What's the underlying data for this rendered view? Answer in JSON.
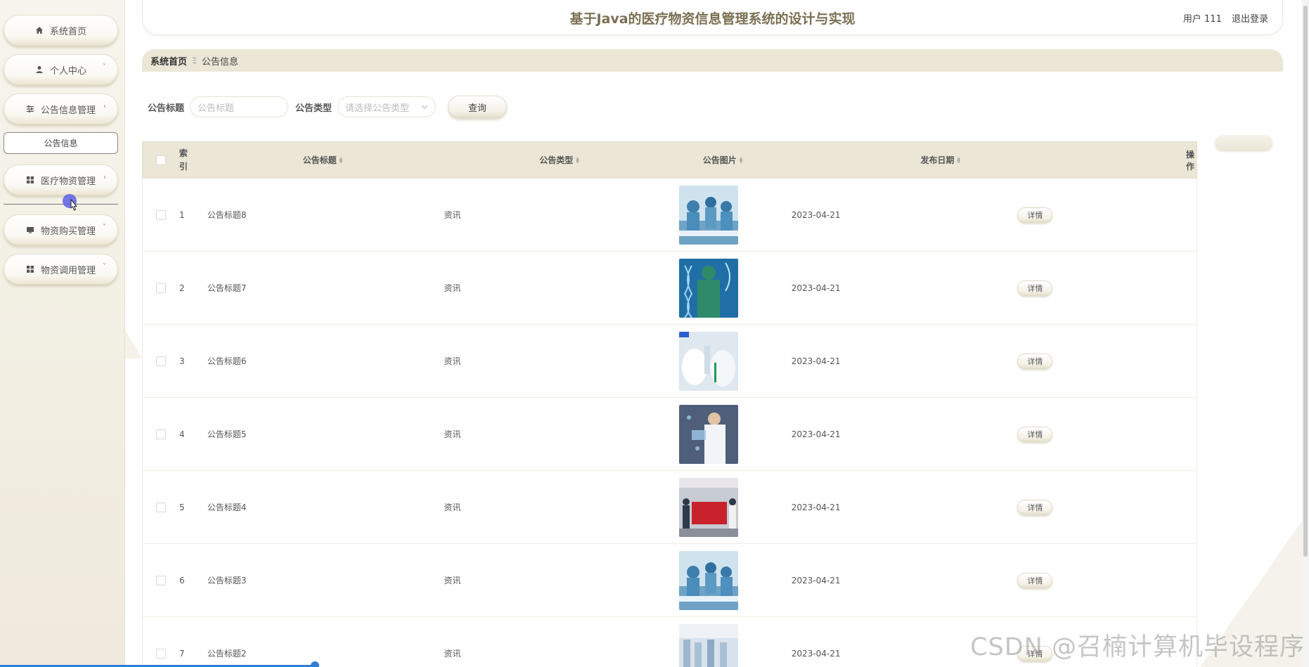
{
  "header": {
    "title": "基于Java的医疗物资信息管理系统的设计与实现",
    "user_label": "用户 111",
    "logout_label": "退出登录"
  },
  "sidebar": {
    "items": [
      {
        "label": "系统首页",
        "icon": "home-icon"
      },
      {
        "label": "个人中心",
        "icon": "user-icon",
        "chevron": "˅"
      },
      {
        "label": "公告信息管理",
        "icon": "sliders-icon",
        "chevron": "‹"
      },
      {
        "label": "医疗物资管理",
        "icon": "grid-icon",
        "chevron": "‹"
      },
      {
        "label": "物资购买管理",
        "icon": "monitor-icon",
        "chevron": "˅"
      },
      {
        "label": "物资调用管理",
        "icon": "grid-icon",
        "chevron": "˅"
      }
    ],
    "submenu_item": "公告信息"
  },
  "breadcrumb": {
    "home": "系统首页",
    "separator": "Ξ",
    "current": "公告信息"
  },
  "search": {
    "title_label": "公告标题",
    "title_placeholder": "公告标题",
    "type_label": "公告类型",
    "type_placeholder": "请选择公告类型",
    "query_button": "查询"
  },
  "table": {
    "columns": [
      "索引",
      "公告标题",
      "公告类型",
      "公告图片",
      "发布日期",
      "操作"
    ],
    "detail_label": "详情",
    "rows": [
      {
        "index": "1",
        "title": "公告标题8",
        "type": "资讯",
        "date": "2023-04-21",
        "image": "surgery-team-image"
      },
      {
        "index": "2",
        "title": "公告标题7",
        "type": "资讯",
        "date": "2023-04-21",
        "image": "doctor-dna-image"
      },
      {
        "index": "3",
        "title": "公告标题6",
        "type": "资讯",
        "date": "2023-04-21",
        "image": "vial-gloves-image"
      },
      {
        "index": "4",
        "title": "公告标题5",
        "type": "资讯",
        "date": "2023-04-21",
        "image": "doctor-tablet-image"
      },
      {
        "index": "5",
        "title": "公告标题4",
        "type": "资讯",
        "date": "2023-04-21",
        "image": "medical-team-banner-image"
      },
      {
        "index": "6",
        "title": "公告标题3",
        "type": "资讯",
        "date": "2023-04-21",
        "image": "surgery-team-image"
      },
      {
        "index": "7",
        "title": "公告标题2",
        "type": "资讯",
        "date": "2023-04-21",
        "image": "lab-room-image"
      }
    ]
  },
  "watermark": "CSDN @召楠计算机毕设程序",
  "colors": {
    "accent": "#ebe6d6",
    "title": "#7a6f52",
    "sidebar": "#f3efe3"
  }
}
